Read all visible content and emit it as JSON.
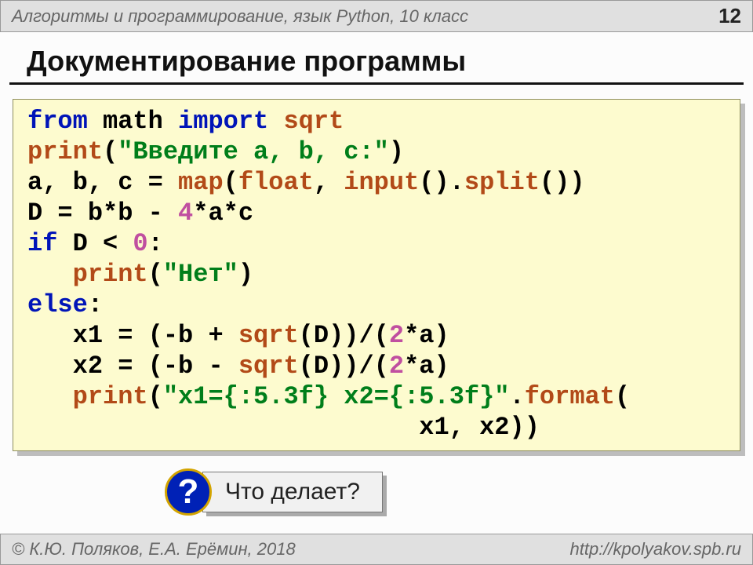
{
  "header": {
    "course": "Алгоритмы и программирование, язык Python, 10 класс",
    "page": "12"
  },
  "title": "Документирование программы",
  "code": {
    "l1_from": "from",
    "l1_math": " math ",
    "l1_import": "import",
    "l1_sqrt": " sqrt",
    "l2_print": "print",
    "l2_lp": "(",
    "l2_str": "\"Введите a, b, c:\"",
    "l2_rp": ")",
    "l3_lhs": "a, b, c = ",
    "l3_map": "map",
    "l3_mid1": "(",
    "l3_float": "float",
    "l3_mid2": ", ",
    "l3_input": "input",
    "l3_mid3": "().",
    "l3_split": "split",
    "l3_end": "())",
    "l4_a": "D = b*b - ",
    "l4_4": "4",
    "l4_b": "*a*c",
    "l5_if": "if",
    "l5_rest": " D < ",
    "l5_zero": "0",
    "l5_colon": ":",
    "l6_pad": "   ",
    "l6_print": "print",
    "l6_lp": "(",
    "l6_str": "\"Нет\"",
    "l6_rp": ")",
    "l7_else": "else",
    "l7_colon": ":",
    "l8_pad": "   x1 = (-b + ",
    "l8_sqrt": "sqrt",
    "l8_mid": "(D))/(",
    "l8_two": "2",
    "l8_end": "*a)",
    "l9_pad": "   x2 = (-b - ",
    "l9_sqrt": "sqrt",
    "l9_mid": "(D))/(",
    "l9_two": "2",
    "l9_end": "*a)",
    "l10_pad": "   ",
    "l10_print": "print",
    "l10_lp": "(",
    "l10_str": "\"x1={:5.3f} x2={:5.3f}\"",
    "l10_dot": ".",
    "l10_format": "format",
    "l10_end": "(",
    "l11": "                          x1, x2))"
  },
  "callout": {
    "mark": "?",
    "text": "Что делает?"
  },
  "footer": {
    "copyright": "© К.Ю. Поляков, Е.А. Ерёмин, 2018",
    "url": "http://kpolyakov.spb.ru"
  }
}
